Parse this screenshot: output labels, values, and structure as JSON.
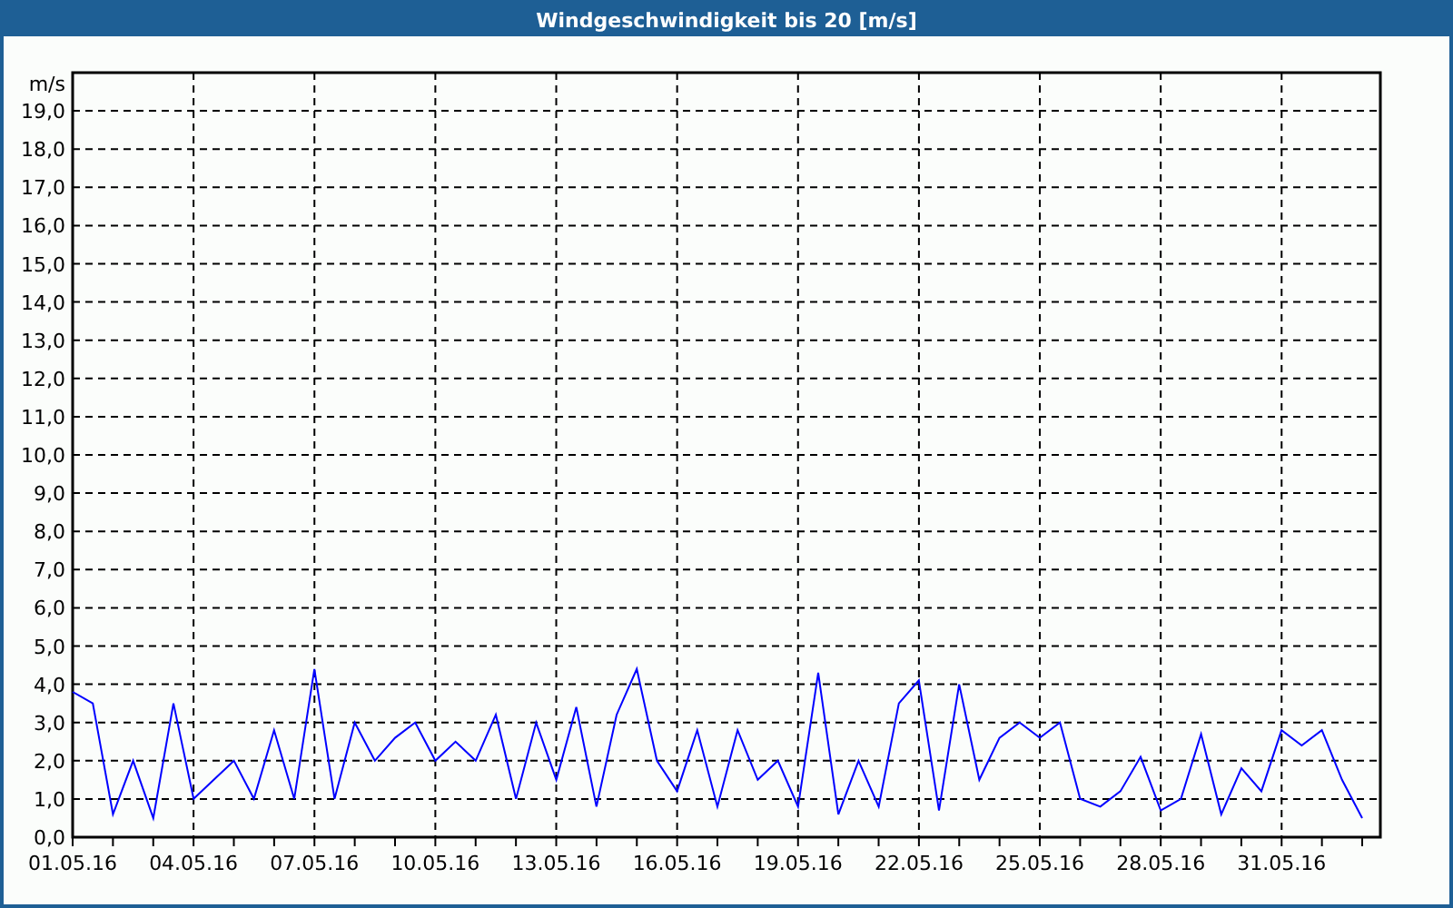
{
  "window": {
    "title": "Windgeschwindigkeit bis 20 [m/s]"
  },
  "chart": {
    "chart_data": {
      "type": "line",
      "grid": true,
      "ylabel": "m/s",
      "ylim": [
        0,
        20
      ],
      "categories": [
        "01.05.16",
        null,
        null,
        null,
        null,
        null,
        "04.05.16",
        null,
        null,
        null,
        null,
        null,
        "07.05.16",
        null,
        null,
        null,
        null,
        null,
        "10.05.16",
        null,
        null,
        null,
        null,
        null,
        "13.05.16",
        null,
        null,
        null,
        null,
        null,
        "16.05.16",
        null,
        null,
        null,
        null,
        null,
        "19.05.16",
        null,
        null,
        null,
        null,
        null,
        "22.05.16",
        null,
        null,
        null,
        null,
        null,
        "25.05.16",
        null,
        null,
        null,
        null,
        null,
        "28.05.16",
        null,
        null,
        null,
        null,
        null,
        "31.05.16",
        null,
        null,
        null,
        null
      ],
      "series": [
        {
          "color": "#0000ff",
          "values": [
            3.8,
            3.5,
            0.6,
            2.0,
            0.5,
            3.5,
            1.0,
            1.5,
            2.0,
            1.0,
            2.8,
            1.0,
            4.4,
            1.0,
            3.0,
            2.0,
            2.6,
            3.0,
            2.0,
            2.5,
            2.0,
            3.2,
            1.0,
            3.0,
            1.5,
            3.4,
            0.8,
            3.2,
            4.4,
            2.0,
            1.2,
            2.8,
            0.8,
            2.8,
            1.5,
            2.0,
            0.8,
            4.3,
            0.6,
            2.0,
            0.8,
            3.5,
            4.1,
            0.7,
            4.0,
            1.5,
            2.6,
            3.0,
            2.6,
            3.0,
            1.0,
            0.8,
            1.2,
            2.1,
            0.7,
            1.0,
            2.7,
            0.6,
            1.8,
            1.2,
            2.8,
            2.4,
            2.8,
            1.5,
            0.5
          ]
        }
      ],
      "yticks": [
        {
          "value": 0,
          "label": "0,0"
        },
        {
          "value": 1,
          "label": "1,0"
        },
        {
          "value": 2,
          "label": "2,0"
        },
        {
          "value": 3,
          "label": "3,0"
        },
        {
          "value": 4,
          "label": "4,0"
        },
        {
          "value": 5,
          "label": "5,0"
        },
        {
          "value": 6,
          "label": "6,0"
        },
        {
          "value": 7,
          "label": "7,0"
        },
        {
          "value": 8,
          "label": "8,0"
        },
        {
          "value": 9,
          "label": "9,0"
        },
        {
          "value": 10,
          "label": "10,0"
        },
        {
          "value": 11,
          "label": "11,0"
        },
        {
          "value": 12,
          "label": "12,0"
        },
        {
          "value": 13,
          "label": "13,0"
        },
        {
          "value": 14,
          "label": "14,0"
        },
        {
          "value": 15,
          "label": "15,0"
        },
        {
          "value": 16,
          "label": "16,0"
        },
        {
          "value": 17,
          "label": "17,0"
        },
        {
          "value": 18,
          "label": "18,0"
        },
        {
          "value": 19,
          "label": "19,0"
        }
      ]
    }
  }
}
